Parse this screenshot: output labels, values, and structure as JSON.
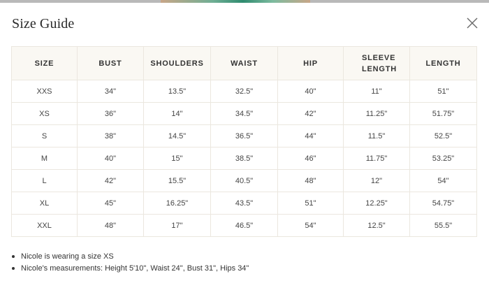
{
  "modal": {
    "title": "Size Guide",
    "close_icon": "close-icon"
  },
  "table": {
    "headers": [
      "SIZE",
      "BUST",
      "SHOULDERS",
      "WAIST",
      "HIP",
      "SLEEVE LENGTH",
      "LENGTH"
    ],
    "rows": [
      [
        "XXS",
        "34\"",
        "13.5\"",
        "32.5\"",
        "40\"",
        "11\"",
        "51\""
      ],
      [
        "XS",
        "36\"",
        "14\"",
        "34.5\"",
        "42\"",
        "11.25\"",
        "51.75\""
      ],
      [
        "S",
        "38\"",
        "14.5\"",
        "36.5\"",
        "44\"",
        "11.5\"",
        "52.5\""
      ],
      [
        "M",
        "40\"",
        "15\"",
        "38.5\"",
        "46\"",
        "11.75\"",
        "53.25\""
      ],
      [
        "L",
        "42\"",
        "15.5\"",
        "40.5\"",
        "48\"",
        "12\"",
        "54\""
      ],
      [
        "XL",
        "45\"",
        "16.25\"",
        "43.5\"",
        "51\"",
        "12.25\"",
        "54.75\""
      ],
      [
        "XXL",
        "48\"",
        "17\"",
        "46.5\"",
        "54\"",
        "12.5\"",
        "55.5\""
      ]
    ]
  },
  "notes": [
    "Nicole is wearing a size XS",
    "Nicole's measurements: Height 5'10\", Waist 24\", Bust 31\", Hips 34\""
  ],
  "colors": {
    "header_background": "#faf8f3",
    "border": "#ebe7df",
    "text": "#333333"
  }
}
